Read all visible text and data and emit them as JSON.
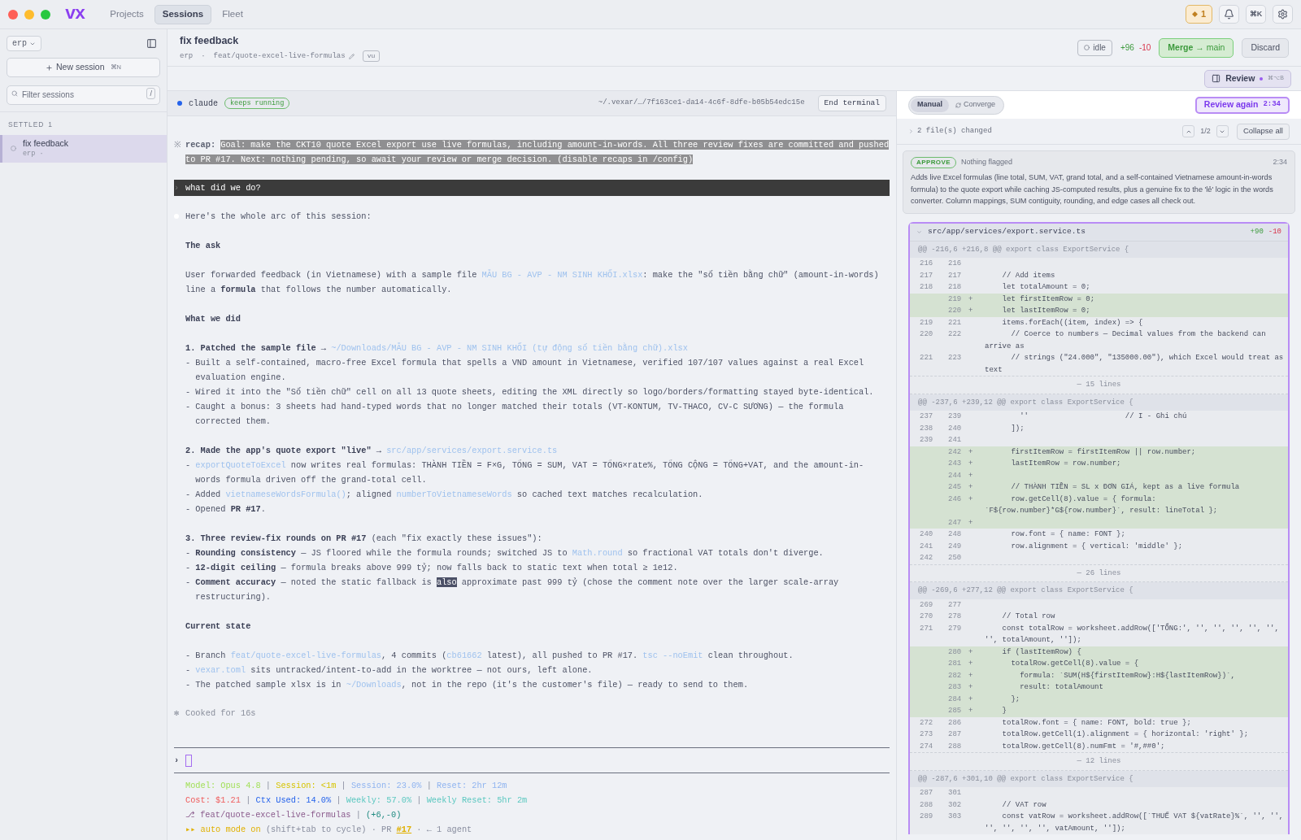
{
  "topbar": {
    "logo": "vx",
    "tabs": [
      {
        "label": "Projects",
        "selected": false
      },
      {
        "label": "Sessions",
        "selected": true
      },
      {
        "label": "Fleet",
        "selected": false
      }
    ],
    "notifications_count": "1",
    "command_key": "⌘K"
  },
  "sidebar": {
    "project": "erp",
    "new_session": {
      "label": "New session",
      "shortcut": "⌘N"
    },
    "filter": {
      "placeholder": "Filter sessions",
      "shortcut": "/"
    },
    "section": {
      "label": "SETTLED",
      "count": "1"
    },
    "sessions": [
      {
        "title": "fix feedback",
        "subtitle": "erp ·",
        "selected": true
      }
    ]
  },
  "header": {
    "title": "fix feedback",
    "project": "erp",
    "separator": "·",
    "branch": "feat/quote-excel-live-formulas",
    "tag": "vu",
    "status": "idle",
    "additions": "+96",
    "deletions": "-10",
    "merge": {
      "label": "Merge",
      "target": "→ main"
    },
    "discard": "Discard",
    "review_toggle": {
      "label": "Review",
      "shortcut": "⌘⌥B",
      "selected": true
    }
  },
  "terminal": {
    "agent": "claude",
    "badge": "keeps running",
    "path": "~/.vexar/…/7f163ce1-da14-4c6f-8dfe-b05b54edc15e",
    "end_button": "End terminal",
    "recap": {
      "marker": "※",
      "label": "recap:",
      "text": "Goal: make the CKT10 quote Excel export use live formulas, including amount-in-words. All three review fixes are committed and pushed to PR #17. Next: nothing pending, so await your review or merge decision. (disable recaps in /config)"
    },
    "prompt": {
      "marker": "›",
      "text": "what did we do?"
    },
    "response": [
      [
        {
          "kind": "plain",
          "segments": [
            {
              "text": "Here's the whole arc of this session:"
            }
          ]
        }
      ],
      [
        {
          "kind": "plain",
          "segments": [
            {
              "text": "The ask",
              "kind": "bold"
            }
          ]
        }
      ],
      [
        {
          "kind": "plain",
          "segments": [
            {
              "text": "User forwarded feedback (in Vietnamese) with a sample file "
            },
            {
              "text": "MẪU BG - AVP - NM SINH KHỐI.xlsx",
              "kind": "link"
            },
            {
              "text": ": make the \"số tiền bằng chữ\" (amount-in-words) line a "
            },
            {
              "text": "formula",
              "kind": "bold"
            },
            {
              "text": " that follows the number automatically."
            }
          ]
        }
      ],
      [
        {
          "kind": "plain",
          "segments": [
            {
              "text": "What we did",
              "kind": "bold"
            }
          ]
        }
      ],
      [
        {
          "kind": "plain",
          "segments": [
            {
              "text": "1. Patched the sample file → ",
              "kind": "bold"
            },
            {
              "text": "~/Downloads/MẪU BG - AVP - NM SINH KHỐI (tự động số tiền bằng chữ).xlsx",
              "kind": "link"
            }
          ]
        },
        {
          "kind": "bullet",
          "segments": [
            {
              "text": "- Built a self-contained, macro-free Excel formula that spells a VND amount in Vietnamese, verified 107/107 values against a real Excel evaluation engine."
            }
          ]
        },
        {
          "kind": "bullet",
          "segments": [
            {
              "text": "- Wired it into the \"Số tiền chữ\" cell on all 13 quote sheets, editing the XML directly so logo/borders/formatting stayed byte-identical."
            }
          ]
        },
        {
          "kind": "bullet",
          "segments": [
            {
              "text": "- Caught a bonus: 3 sheets had hand-typed words that no longer matched their totals (VT-KONTUM, TV-THACO, CV-C SƯƠNG) — the formula corrected them."
            }
          ]
        }
      ],
      [
        {
          "kind": "plain",
          "segments": [
            {
              "text": "2. Made the app's quote export \"live\" → ",
              "kind": "bold"
            },
            {
              "text": "src/app/services/export.service.ts",
              "kind": "link"
            }
          ]
        },
        {
          "kind": "bullet",
          "segments": [
            {
              "text": "- "
            },
            {
              "text": "exportQuoteToExcel",
              "kind": "link"
            },
            {
              "text": " now writes real formulas: THÀNH TIỀN = F×G, TỔNG = SUM, VAT = TỔNG×rate%, TỔNG CỘNG = TỔNG+VAT, and the amount-in-words formula driven off the grand-total cell."
            }
          ]
        },
        {
          "kind": "bullet",
          "segments": [
            {
              "text": "- Added "
            },
            {
              "text": "vietnameseWordsFormula()",
              "kind": "link"
            },
            {
              "text": "; aligned "
            },
            {
              "text": "numberToVietnameseWords",
              "kind": "link"
            },
            {
              "text": " so cached text matches recalculation."
            }
          ]
        },
        {
          "kind": "bullet",
          "segments": [
            {
              "text": "- Opened "
            },
            {
              "text": "PR #17",
              "kind": "bold"
            },
            {
              "text": "."
            }
          ]
        }
      ],
      [
        {
          "kind": "plain",
          "segments": [
            {
              "text": "3. Three review-fix rounds on PR #17",
              "kind": "bold"
            },
            {
              "text": " (each \"fix exactly these issues\"):"
            }
          ]
        },
        {
          "kind": "bullet",
          "segments": [
            {
              "text": "- "
            },
            {
              "text": "Rounding consistency",
              "kind": "bold"
            },
            {
              "text": " — JS floored while the formula rounds; switched JS to "
            },
            {
              "text": "Math.round",
              "kind": "link"
            },
            {
              "text": " so fractional VAT totals don't diverge."
            }
          ]
        },
        {
          "kind": "bullet",
          "segments": [
            {
              "text": "- "
            },
            {
              "text": "12-digit ceiling",
              "kind": "bold"
            },
            {
              "text": " — formula breaks above 999 tỷ; now falls back to static text when total ≥ 1e12."
            }
          ]
        },
        {
          "kind": "bullet",
          "segments": [
            {
              "text": "- "
            },
            {
              "text": "Comment accuracy",
              "kind": "bold"
            },
            {
              "text": " — noted the static fallback is "
            },
            {
              "text": "also",
              "kind": "selected"
            },
            {
              "text": " approximate past 999 tỷ (chose the comment note over the larger scale-array restructuring)."
            }
          ]
        }
      ],
      [
        {
          "kind": "plain",
          "segments": [
            {
              "text": "Current state",
              "kind": "bold"
            }
          ]
        }
      ],
      [
        {
          "kind": "bullet",
          "segments": [
            {
              "text": "- Branch "
            },
            {
              "text": "feat/quote-excel-live-formulas",
              "kind": "link"
            },
            {
              "text": ", 4 commits ("
            },
            {
              "text": "cb61662",
              "kind": "link"
            },
            {
              "text": " latest), all pushed to PR #17. "
            },
            {
              "text": "tsc --noEmit",
              "kind": "link"
            },
            {
              "text": " clean throughout."
            }
          ]
        },
        {
          "kind": "bullet",
          "segments": [
            {
              "text": "- "
            },
            {
              "text": "vexar.toml",
              "kind": "link"
            },
            {
              "text": " sits untracked/intent-to-add in the worktree — not ours, left alone."
            }
          ]
        },
        {
          "kind": "bullet",
          "segments": [
            {
              "text": "- The patched sample xlsx is in "
            },
            {
              "text": "~/Downloads",
              "kind": "link"
            },
            {
              "text": ", not in the repo (it's the customer's file) — ready to send to them."
            }
          ]
        }
      ]
    ],
    "footer": {
      "marker": "✻",
      "text": "Cooked for 16s"
    },
    "input": {
      "marker": "›"
    },
    "status_lines": [
      [
        {
          "text": "Model: Opus 4.8",
          "color": "#a3e05a"
        },
        {
          "text": " | "
        },
        {
          "text": "Session: <1m",
          "color": "#d6c400"
        },
        {
          "text": " | "
        },
        {
          "text": "Session: 23.0%",
          "color": "#8fb4f0"
        },
        {
          "text": " | "
        },
        {
          "text": "Reset: 2hr 12m",
          "color": "#8fb4f0"
        }
      ],
      [
        {
          "text": "Cost: $1.21",
          "color": "#ef5b5b"
        },
        {
          "text": " | "
        },
        {
          "text": "Ctx Used: 14.0%",
          "color": "#2563eb"
        },
        {
          "text": " | "
        },
        {
          "text": "Weekly: 57.0%",
          "color": "#5cc8c0"
        },
        {
          "text": " | "
        },
        {
          "text": "Weekly Reset: 5hr 2m",
          "color": "#5cc8c0"
        }
      ],
      [
        {
          "text": "⎇ feat/quote-excel-live-formulas",
          "color": "#8a5a8c"
        },
        {
          "text": " | "
        },
        {
          "text": "(+6,-0)",
          "color": "#1f8a80"
        }
      ],
      [
        {
          "text": "▸▸ auto mode on",
          "color": "#e0b000"
        },
        {
          "text": " (shift+tab to cycle) · PR "
        },
        {
          "text": "#17",
          "color": "#e0b000"
        },
        {
          "text": " · ← 1 agent"
        }
      ]
    ]
  },
  "review": {
    "modes": [
      {
        "label": "Manual",
        "selected": true
      },
      {
        "label": "Converge",
        "selected": false
      }
    ],
    "review_again": {
      "label": "Review again",
      "time": "2:34"
    },
    "files_changed": "2 file(s) changed",
    "pager": "1/2",
    "collapse": "Collapse all",
    "card": {
      "verdict": "APPROVE",
      "note": "Nothing flagged",
      "time": "2:34",
      "text": "Adds live Excel formulas (line total, SUM, VAT, grand total, and a self-contained Vietnamese amount-in-words formula) to the quote export while caching JS-computed results, plus a genuine fix to the 'lẻ' logic in the words converter. Column mappings, SUM contiguity, rounding, and edge cases all check out."
    },
    "diff": {
      "file": "src/app/services/export.service.ts",
      "additions": "+90",
      "deletions": "-10",
      "expanded": true,
      "hunks": [
        {
          "header": "@@ -216,6 +216,8 @@ export class ExportService {",
          "fold": "— 15 lines",
          "lines": [
            {
              "kind": "context",
              "old": "216",
              "new": "216"
            },
            {
              "kind": "context",
              "old": "217",
              "new": "217",
              "code": "    // Add items"
            },
            {
              "kind": "context",
              "old": "218",
              "new": "218",
              "code": "    let totalAmount = 0;"
            },
            {
              "kind": "add",
              "new": "219",
              "sign": "+",
              "code": "    let firstItemRow = 0;"
            },
            {
              "kind": "add",
              "new": "220",
              "sign": "+",
              "code": "    let lastItemRow = 0;"
            },
            {
              "kind": "context",
              "old": "219",
              "new": "221",
              "code": "    items.forEach((item, index) => {"
            },
            {
              "kind": "context",
              "old": "220",
              "new": "222",
              "code": "      // Coerce to numbers — Decimal values from the backend can arrive as"
            },
            {
              "kind": "context",
              "old": "221",
              "new": "223",
              "code": "      // strings (\"24.000\", \"135000.00\"), which Excel would treat as text"
            }
          ]
        },
        {
          "header": "@@ -237,6 +239,12 @@ export class ExportService {",
          "fold": "— 26 lines",
          "lines": [
            {
              "kind": "context",
              "old": "237",
              "new": "239",
              "code": "        ''                      // I - Ghi chú"
            },
            {
              "kind": "context",
              "old": "238",
              "new": "240",
              "code": "      ]);"
            },
            {
              "kind": "context",
              "old": "239",
              "new": "241"
            },
            {
              "kind": "add",
              "new": "242",
              "sign": "+",
              "code": "      firstItemRow = firstItemRow || row.number;"
            },
            {
              "kind": "add",
              "new": "243",
              "sign": "+",
              "code": "      lastItemRow = row.number;"
            },
            {
              "kind": "add",
              "new": "244",
              "sign": "+"
            },
            {
              "kind": "add",
              "new": "245",
              "sign": "+",
              "code": "      // THÀNH TIỀN = SL x ĐƠN GIÁ, kept as a live formula"
            },
            {
              "kind": "add",
              "new": "246",
              "sign": "+",
              "code": "      row.getCell(8).value = { formula: `F${row.number}*G${row.number}`, result: lineTotal };"
            },
            {
              "kind": "add",
              "new": "247",
              "sign": "+"
            },
            {
              "kind": "context",
              "old": "240",
              "new": "248",
              "code": "      row.font = { name: FONT };"
            },
            {
              "kind": "context",
              "old": "241",
              "new": "249",
              "code": "      row.alignment = { vertical: 'middle' };"
            },
            {
              "kind": "context",
              "old": "242",
              "new": "250"
            }
          ]
        },
        {
          "header": "@@ -269,6 +277,12 @@ export class ExportService {",
          "fold": "— 12 lines",
          "lines": [
            {
              "kind": "context",
              "old": "269",
              "new": "277"
            },
            {
              "kind": "context",
              "old": "270",
              "new": "278",
              "code": "    // Total row"
            },
            {
              "kind": "context",
              "old": "271",
              "new": "279",
              "code": "    const totalRow = worksheet.addRow(['TỔNG:', '', '', '', '', '', '', totalAmount, '']);"
            },
            {
              "kind": "add",
              "new": "280",
              "sign": "+",
              "code": "    if (lastItemRow) {"
            },
            {
              "kind": "add",
              "new": "281",
              "sign": "+",
              "code": "      totalRow.getCell(8).value = {"
            },
            {
              "kind": "add",
              "new": "282",
              "sign": "+",
              "code": "        formula: `SUM(H${firstItemRow}:H${lastItemRow})`,"
            },
            {
              "kind": "add",
              "new": "283",
              "sign": "+",
              "code": "        result: totalAmount"
            },
            {
              "kind": "add",
              "new": "284",
              "sign": "+",
              "code": "      };"
            },
            {
              "kind": "add",
              "new": "285",
              "sign": "+",
              "code": "    }"
            },
            {
              "kind": "context",
              "old": "272",
              "new": "286",
              "code": "    totalRow.font = { name: FONT, bold: true };"
            },
            {
              "kind": "context",
              "old": "273",
              "new": "287",
              "code": "    totalRow.getCell(1).alignment = { horizontal: 'right' };"
            },
            {
              "kind": "context",
              "old": "274",
              "new": "288",
              "code": "    totalRow.getCell(8).numFmt = '#,##0';"
            }
          ]
        },
        {
          "header": "@@ -287,6 +301,10 @@ export class ExportService {",
          "lines": [
            {
              "kind": "context",
              "old": "287",
              "new": "301"
            },
            {
              "kind": "context",
              "old": "288",
              "new": "302",
              "code": "    // VAT row"
            },
            {
              "kind": "context",
              "old": "289",
              "new": "303",
              "code": "    const vatRow = worksheet.addRow([`THUẾ VAT ${vatRate}%`, '', '', '', '', '', '', vatAmount, '']);"
            }
          ]
        }
      ]
    }
  }
}
